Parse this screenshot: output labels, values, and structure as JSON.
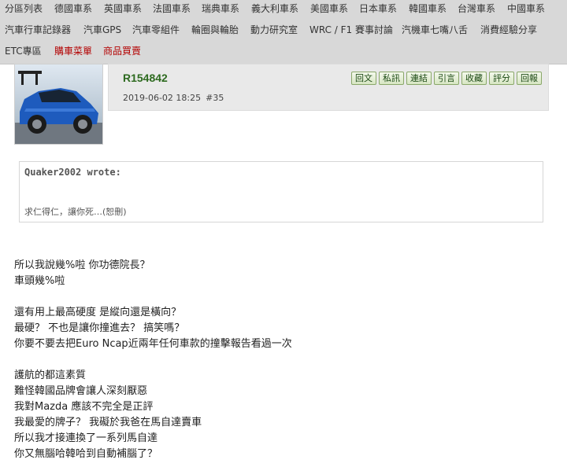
{
  "nav": {
    "row1": [
      "分區列表",
      "德國車系",
      "英國車系",
      "法國車系",
      "瑞典車系",
      "義大利車系",
      "美國車系",
      "日本車系",
      "韓國車系",
      "台灣車系",
      "中國車系"
    ],
    "row2": [
      "汽車行車記錄器",
      "汽車GPS",
      "汽車零組件",
      "輪圈與輪胎",
      "動力研究室",
      "WRC / F1 賽事討論",
      "汽機車七嘴八舌",
      "消費經驗分享"
    ],
    "row3": [
      "ETC專區",
      "購車菜單",
      "商品買賣"
    ]
  },
  "post": {
    "username": "R154842",
    "date": "2019-06-02 18:25",
    "post_number": "#35",
    "actions": [
      "回文",
      "私訊",
      "連結",
      "引言",
      "收藏",
      "評分",
      "回報"
    ],
    "quote": {
      "author": "Quaker2002 wrote:",
      "text": "求仁得仁，讓你死…(恕刪)"
    },
    "body_lines": [
      "所以我說幾%啦 你功德院長？",
      "車頭幾%啦",
      "",
      "還有用上最高硬度 是縱向還是橫向？",
      "最硬？ 不也是讓你撞進去？ 搞笑嗎？",
      "你要不要去把Euro Ncap近兩年任何車款的撞擊報告看過一次",
      "",
      "護航的都這素質",
      "難怪韓國品牌會讓人深刻厭惡",
      "我對Mazda 應該不完全是正評",
      "我最愛的牌子？ 我礙於我爸在馬自達賣車",
      "所以我才接連換了一系列馬自達",
      "你又無腦哈韓哈到自動補腦了？"
    ]
  }
}
